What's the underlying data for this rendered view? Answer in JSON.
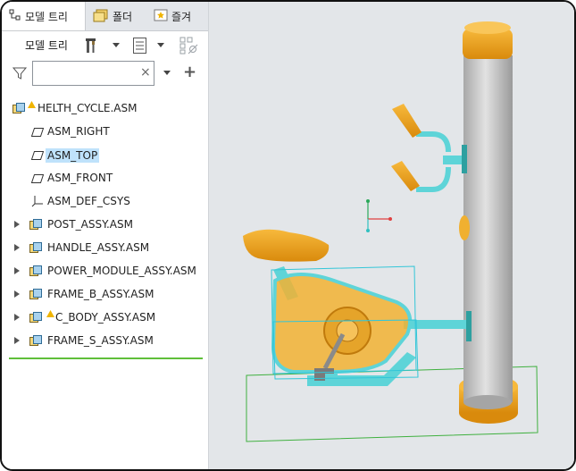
{
  "tabs": [
    {
      "label": "모델 트리",
      "icon": "model-tree-icon",
      "active": true
    },
    {
      "label": "폴더",
      "icon": "folder-icon",
      "active": false
    },
    {
      "label": "즐겨",
      "icon": "favorites-icon",
      "active": false
    }
  ],
  "toolbar": {
    "model_tree_label": "모델 트리",
    "settings_icon": "tools-icon",
    "show_icon": "list-columns-icon",
    "filter_disabled_icon": "column-filter-icon"
  },
  "search": {
    "value": "",
    "placeholder": "",
    "clear_label": "×",
    "filter_icon": "funnel-icon",
    "add_label": "+"
  },
  "tree": {
    "root": {
      "label": "HELTH_CYCLE.ASM",
      "warning": true
    },
    "items": [
      {
        "label": "ASM_RIGHT",
        "type": "datum-plane"
      },
      {
        "label": "ASM_TOP",
        "type": "datum-plane",
        "selected": true
      },
      {
        "label": "ASM_FRONT",
        "type": "datum-plane"
      },
      {
        "label": "ASM_DEF_CSYS",
        "type": "csys"
      },
      {
        "label": "POST_ASSY.ASM",
        "type": "assembly"
      },
      {
        "label": "HANDLE_ASSY.ASM",
        "type": "assembly"
      },
      {
        "label": "POWER_MODULE_ASSY.ASM",
        "type": "assembly"
      },
      {
        "label": "FRAME_B_ASSY.ASM",
        "type": "assembly"
      },
      {
        "label": "C_BODY_ASSY.ASM",
        "type": "assembly",
        "warning": true
      },
      {
        "label": "FRAME_S_ASSY.ASM",
        "type": "assembly"
      }
    ]
  },
  "colors": {
    "viewport_bg": "#e3e6e9",
    "selection": "#bfe2fb",
    "insert_line": "#5fbf3a",
    "highlight_cyan": "#33d0d6",
    "seat_orange": "#f0a21a",
    "post_gray": "#c6c6c6"
  }
}
